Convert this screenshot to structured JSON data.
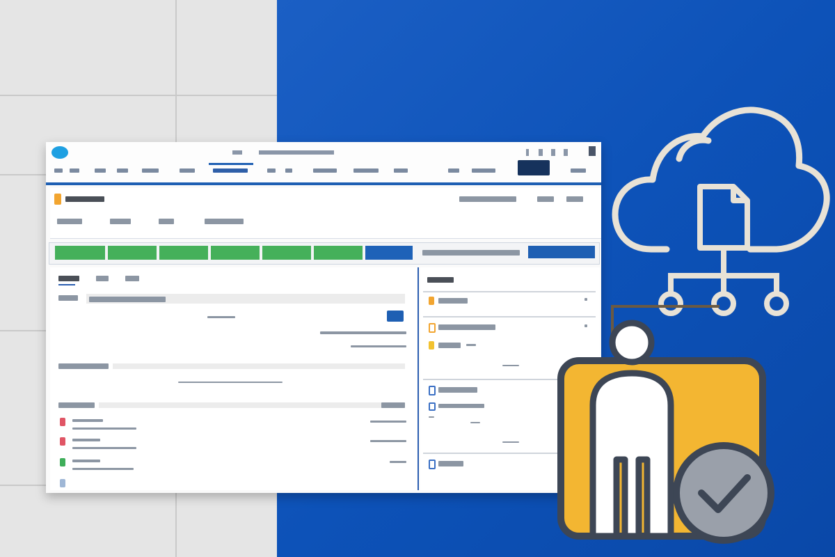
{
  "colors": {
    "background_blue": "#0d52b8",
    "wall_grey": "#e5e5e5",
    "path_complete": "#45b05a",
    "path_current": "#1e62b8",
    "brand_blue": "#1e5fb3",
    "folder_yellow": "#f3b632",
    "icon_outline": "#e8e2d6"
  },
  "icons": {
    "cloud": "cloud-icon",
    "document": "document-icon",
    "person": "person-icon",
    "check": "check-circle-icon",
    "logo": "cloud-logo-icon"
  },
  "path": {
    "steps_total": 7,
    "steps_complete": 6
  }
}
